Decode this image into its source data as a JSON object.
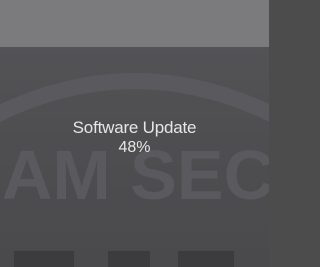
{
  "update": {
    "title": "Software Update",
    "percent": "48%",
    "progress": 0.48
  },
  "watermark": {
    "text": "AM SEC"
  },
  "colors": {
    "top_band": "#7b7b7d",
    "background": "#4e4e50",
    "text": "#e6e6e6",
    "watermark": "#5e5e63"
  }
}
